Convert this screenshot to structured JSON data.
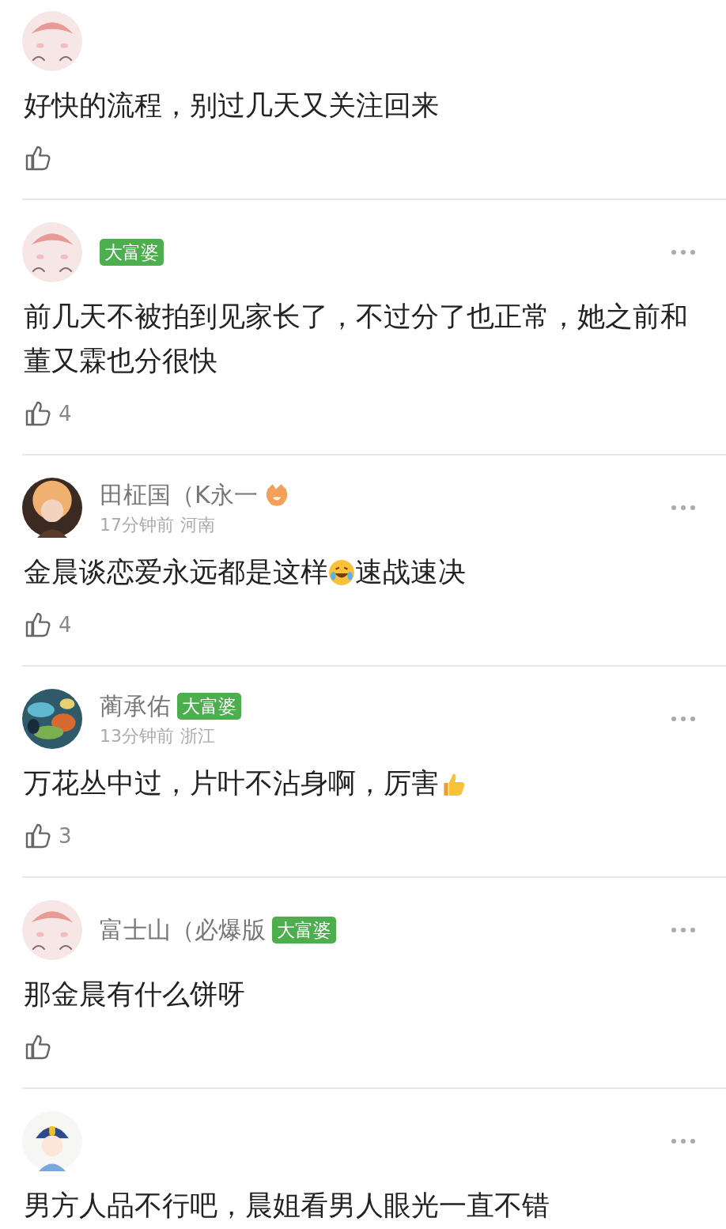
{
  "comments": [
    {
      "content": [
        {
          "kind": "text",
          "text": "好快的流程，别过几天又关注回来"
        }
      ],
      "liked": false
    },
    {
      "badge": "大富婆",
      "content": [
        {
          "kind": "text",
          "text": "前几天不被拍到见家长了，不过分了也正常，她之前和董又霖也分很快"
        }
      ],
      "liked": false,
      "likes": "4",
      "more": true
    },
    {
      "name": "田柾国（K永一",
      "name_icon": true,
      "time": "17分钟前",
      "region": "河南",
      "content": [
        {
          "kind": "text",
          "text": "金晨谈恋爱永远都是这样"
        },
        {
          "kind": "laugh-emoji"
        },
        {
          "kind": "text",
          "text": "速战速决"
        }
      ],
      "liked": false,
      "likes": "4",
      "more": true
    },
    {
      "name": "蔺承佑",
      "badge": "大富婆",
      "time": "13分钟前",
      "region": "浙江",
      "content": [
        {
          "kind": "text",
          "text": "万花丛中过，片叶不沾身啊，厉害"
        },
        {
          "kind": "thumb-emoji"
        }
      ],
      "liked": false,
      "likes": "3",
      "more": true
    },
    {
      "name": "富士山（必爆版",
      "badge": "大富婆",
      "content": [
        {
          "kind": "text",
          "text": "那金晨有什么饼呀"
        }
      ],
      "liked": false,
      "more": true
    },
    {
      "content": [
        {
          "kind": "text",
          "text": "男方人品不行吧，晨姐看男人眼光一直不错"
        }
      ],
      "more": true
    }
  ]
}
